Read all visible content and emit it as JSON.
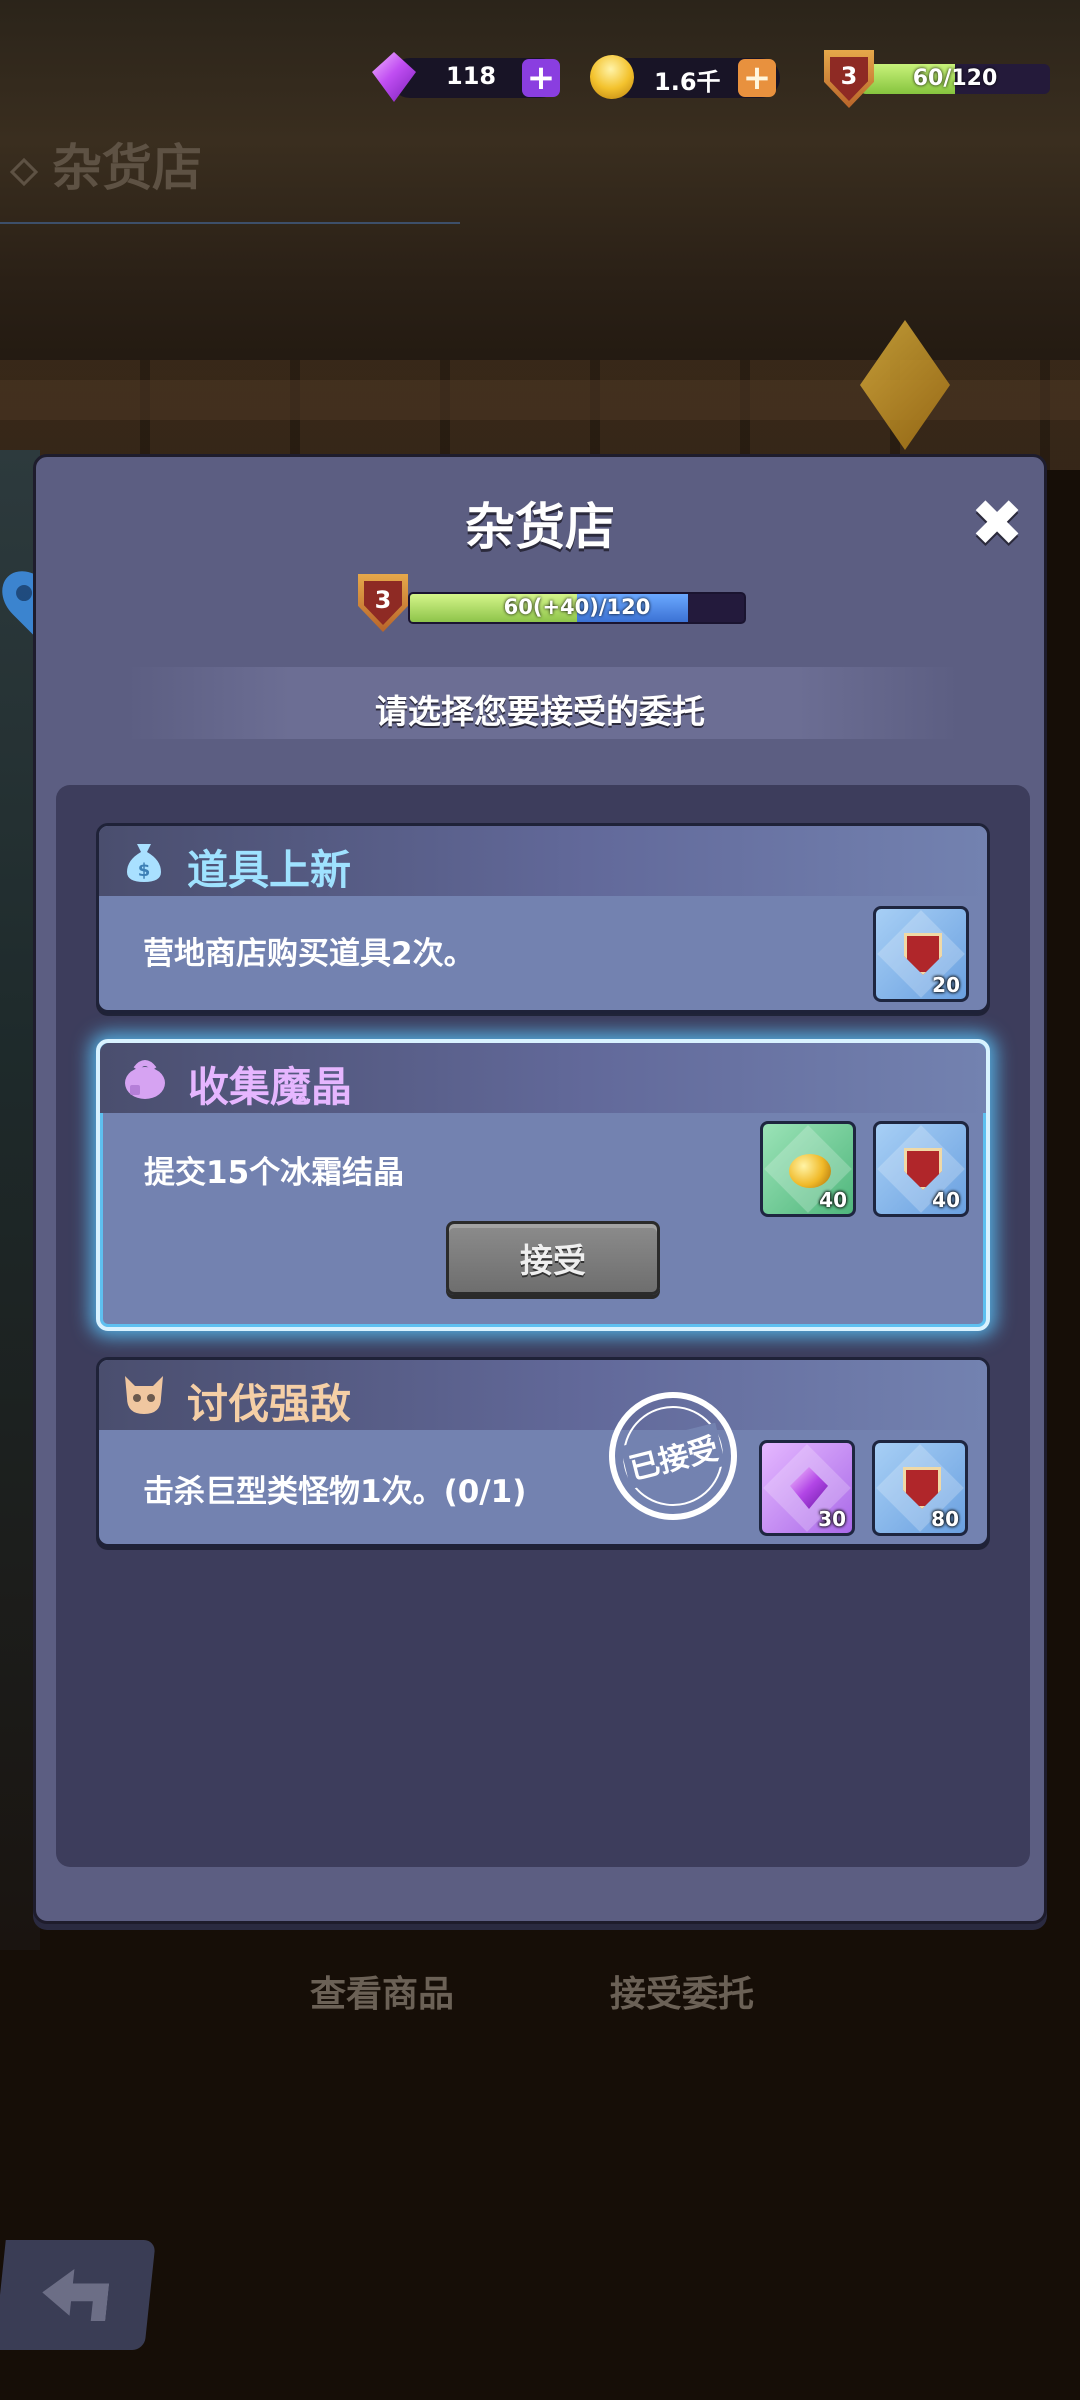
{
  "hud": {
    "gems": "118",
    "coins": "1.6千",
    "level": "3",
    "xp": "60/120",
    "xp_fraction": 0.5
  },
  "location": {
    "title": "杂货店"
  },
  "bottom_actions": {
    "view_goods": "查看商品",
    "accept_commission": "接受委托"
  },
  "dialog": {
    "title": "杂货店",
    "close_symbol": "✖",
    "level": "3",
    "progress_text": "60(+40)/120",
    "progress_current": 60,
    "progress_gain": 40,
    "progress_max": 120,
    "prompt": "请选择您要接受的委托"
  },
  "tasks": [
    {
      "title": "道具上新",
      "title_color": "#9fe2ff",
      "icon": "money-bag-icon",
      "desc": "营地商店购买道具2次。",
      "rewards": [
        {
          "type": "shield-token",
          "color": "blue",
          "count": "20"
        }
      ]
    },
    {
      "title": "收集魔晶",
      "title_color": "#e6b6ff",
      "icon": "crystal-pouch-icon",
      "desc": "提交15个冰霜结晶",
      "accept_label": "接受",
      "rewards": [
        {
          "type": "gold-coins",
          "color": "green",
          "count": "40"
        },
        {
          "type": "shield-token",
          "color": "blue",
          "count": "40"
        }
      ]
    },
    {
      "title": "讨伐强敌",
      "title_color": "#f5cfa6",
      "icon": "skull-icon",
      "desc": "击杀巨型类怪物1次。(0/1)",
      "stamp": "已接受",
      "rewards": [
        {
          "type": "gem",
          "color": "purple",
          "count": "30"
        },
        {
          "type": "shield-token",
          "color": "blue",
          "count": "80"
        }
      ]
    }
  ]
}
